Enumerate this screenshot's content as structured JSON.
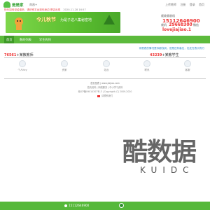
{
  "header": {
    "brand": "是是家",
    "city": "南昌+",
    "links": [
      "上传教师",
      "注册",
      "登录",
      "首页"
    ]
  },
  "notice": {
    "text": "快乐如何说给谁听，请识别平台到你身边 是否出现",
    "time": "2020-11-28 16:57"
  },
  "banner": {
    "title": "今儿秋节",
    "subtitle": "为是子这八集秘密地"
  },
  "contact": {
    "phone_label": "就收就收机",
    "phone": "15112646900",
    "qq_label": "就机",
    "qq": "29668300",
    "wx_label": "微信",
    "wx": "lovejiajiao.1"
  },
  "nav": {
    "items": [
      "首页",
      "数的列表",
      "学生的列"
    ]
  },
  "subnotice": "你是表的情况是你都找到，但是还有高位，也还在表示的行",
  "counts": {
    "left_num": "76561",
    "left_label": "+某教教师",
    "right_num": "43239",
    "right_label": "+某教学生"
  },
  "cards": [
    "个人Key",
    "资家",
    "站台",
    "联系",
    "客服"
  ],
  "footer": {
    "line1": "首页是表 | www.jiajiao.com",
    "line2": "首页资料 | 网络服务 | 中小学习资料",
    "line3": "赣ICP备09014307号-3 | Copyright (C) 2009-2020",
    "line4": "请联系我们"
  },
  "watermark": {
    "big": "酷数据",
    "small": "KUIDC"
  },
  "bottom": {
    "phone": "15112646900"
  },
  "colors": {
    "green": "#5cba3c",
    "red": "#e33333"
  }
}
